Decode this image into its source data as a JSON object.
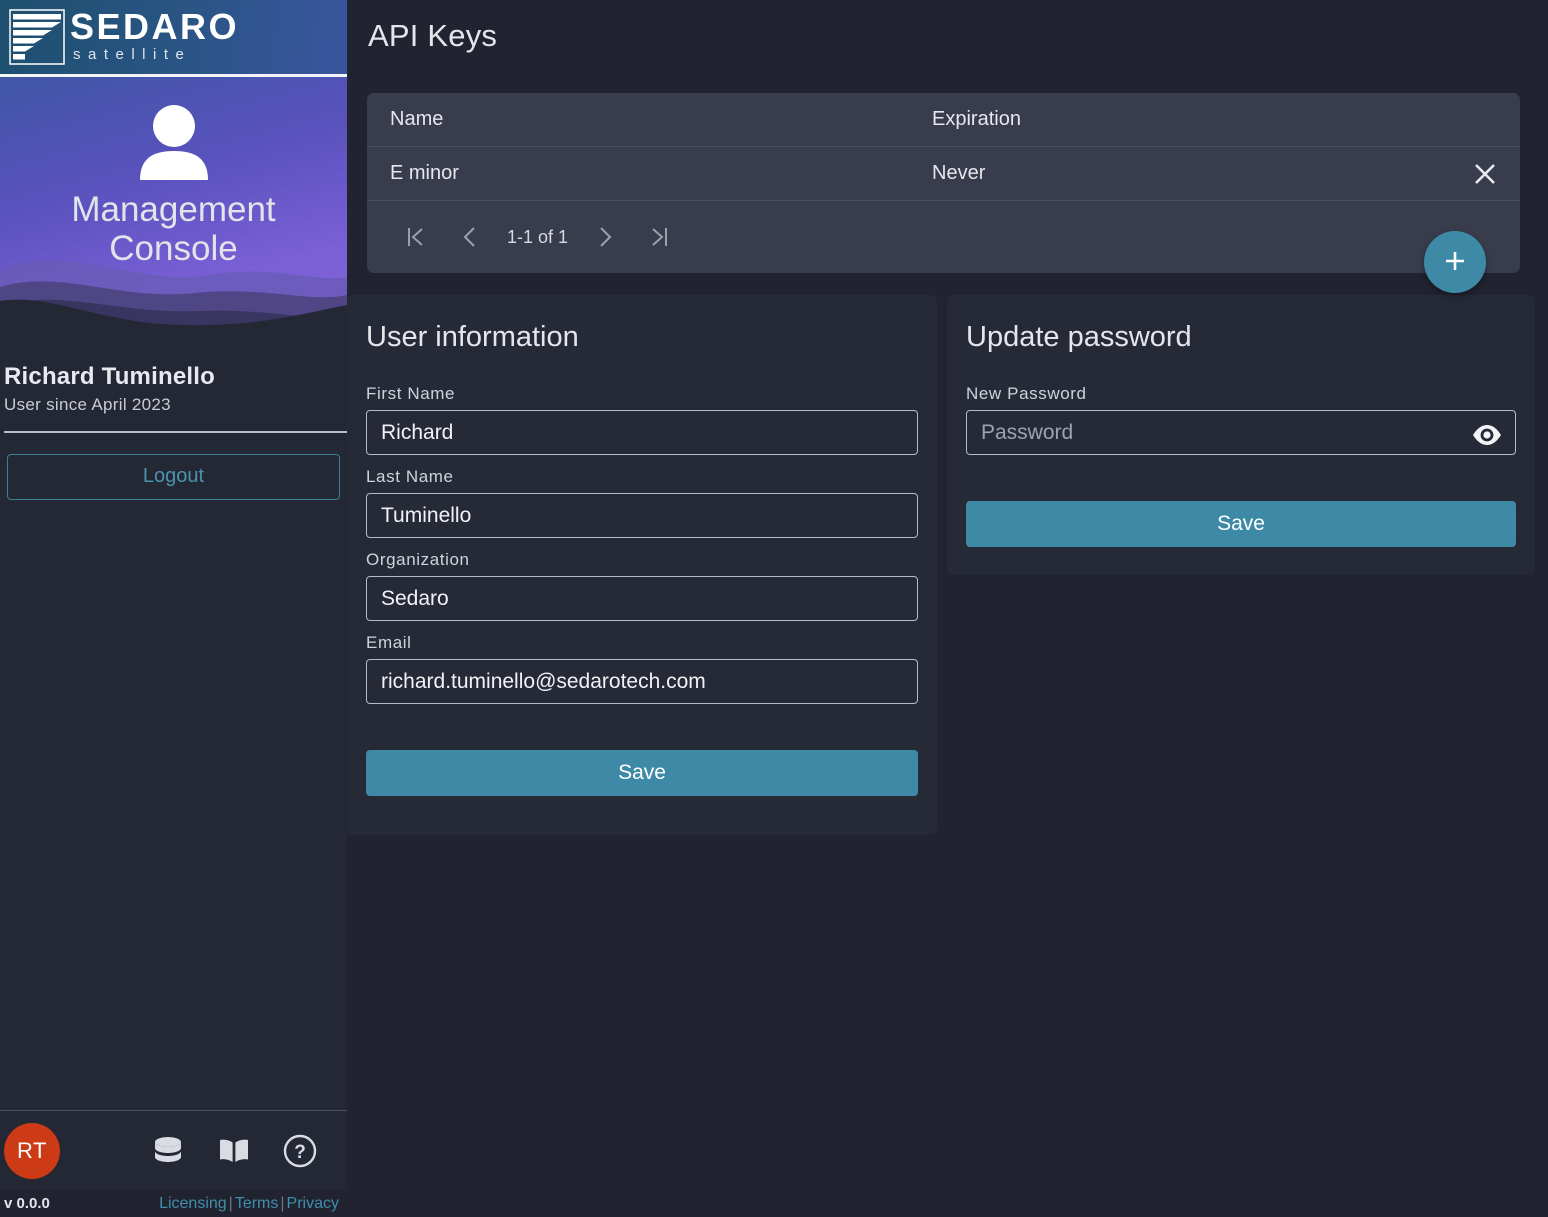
{
  "brand": {
    "name": "SEDARO",
    "sub": "satellite",
    "logo_icon": "sedaro-stripes-logo"
  },
  "sidebar": {
    "hero": {
      "person_icon": "person-icon",
      "title_line1": "Management",
      "title_line2": "Console"
    },
    "user": {
      "name": "Richard Tuminello",
      "since": "User since April 2023",
      "initials": "RT"
    },
    "logout_label": "Logout",
    "footer_icons": [
      {
        "name": "database-icon"
      },
      {
        "name": "book-icon"
      },
      {
        "name": "help-icon"
      }
    ],
    "version": "v 0.0.0",
    "legal": {
      "licensing": "Licensing",
      "terms": "Terms",
      "privacy": "Privacy",
      "separator": "|"
    }
  },
  "main": {
    "page_title": "API Keys",
    "api_keys": {
      "columns": [
        "Name",
        "Expiration"
      ],
      "rows": [
        {
          "name": "E minor",
          "expiration": "Never",
          "delete_icon": "close-icon"
        }
      ],
      "pagination": {
        "first_icon": "first-page-icon",
        "prev_icon": "chevron-left-icon",
        "label": "1-1 of 1",
        "next_icon": "chevron-right-icon",
        "last_icon": "last-page-icon"
      },
      "add_button_icon": "plus-icon"
    },
    "user_information": {
      "title": "User information",
      "fields": [
        {
          "label": "First Name",
          "value": "Richard",
          "placeholder": ""
        },
        {
          "label": "Last Name",
          "value": "Tuminello",
          "placeholder": ""
        },
        {
          "label": "Organization",
          "value": "Sedaro",
          "placeholder": ""
        },
        {
          "label": "Email",
          "value": "richard.tuminello@sedarotech.com",
          "placeholder": ""
        }
      ],
      "save_label": "Save"
    },
    "update_password": {
      "title": "Update password",
      "field": {
        "label": "New Password",
        "value": "",
        "placeholder": "Password"
      },
      "reveal_icon": "eye-icon",
      "save_label": "Save"
    }
  },
  "colors": {
    "accent_teal": "#3e8aa6",
    "avatar_red": "#cc3a16",
    "page_bg": "#212430",
    "card_bg": "#262A36",
    "table_bg": "#383C4C",
    "link_teal": "#3e8fab"
  }
}
